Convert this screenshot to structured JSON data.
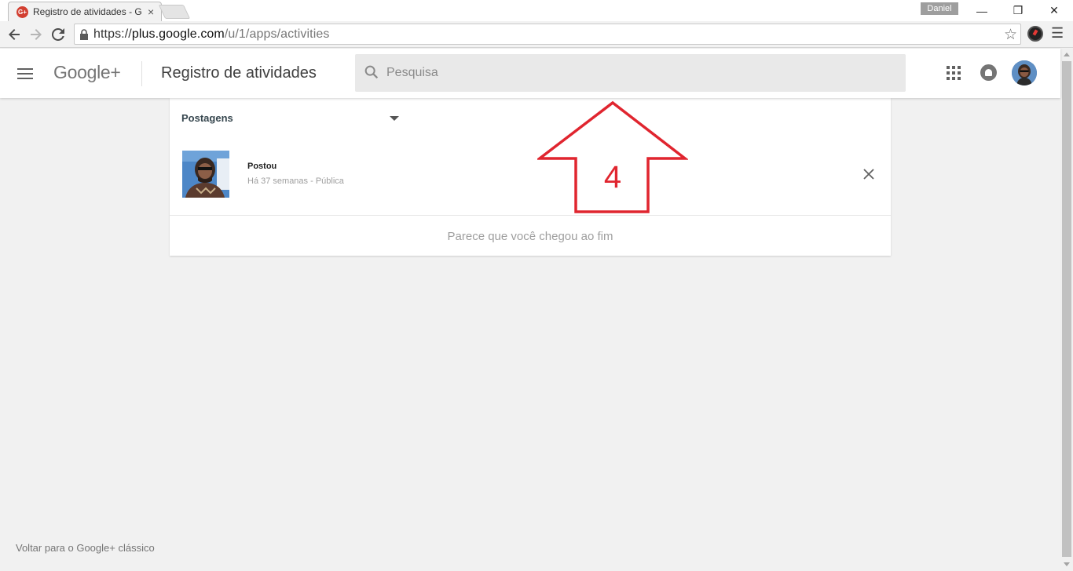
{
  "browser": {
    "tab_title": "Registro de atividades - G",
    "tab_favicon": "G+",
    "tab_close": "×",
    "profile_name": "Daniel",
    "window_controls": {
      "minimize": "—",
      "restore": "❐",
      "close": "✕"
    },
    "url_scheme": "https://",
    "url_host": "plus.google.com",
    "url_path": "/u/1/apps/activities"
  },
  "header": {
    "logo": "Google+",
    "page_title": "Registro de atividades",
    "search_placeholder": "Pesquisa"
  },
  "activity": {
    "filter_label": "Postagens",
    "items": [
      {
        "title": "Postou",
        "meta": "Há 37 semanas - Pública"
      }
    ],
    "end_message": "Parece que você chegou ao fim"
  },
  "annotation": {
    "label": "4",
    "color": "#e0252f"
  },
  "footer": {
    "classic_link": "Voltar para o Google+ clássico"
  },
  "colors": {
    "brand_red": "#d23f31",
    "background": "#f1f1f1"
  }
}
